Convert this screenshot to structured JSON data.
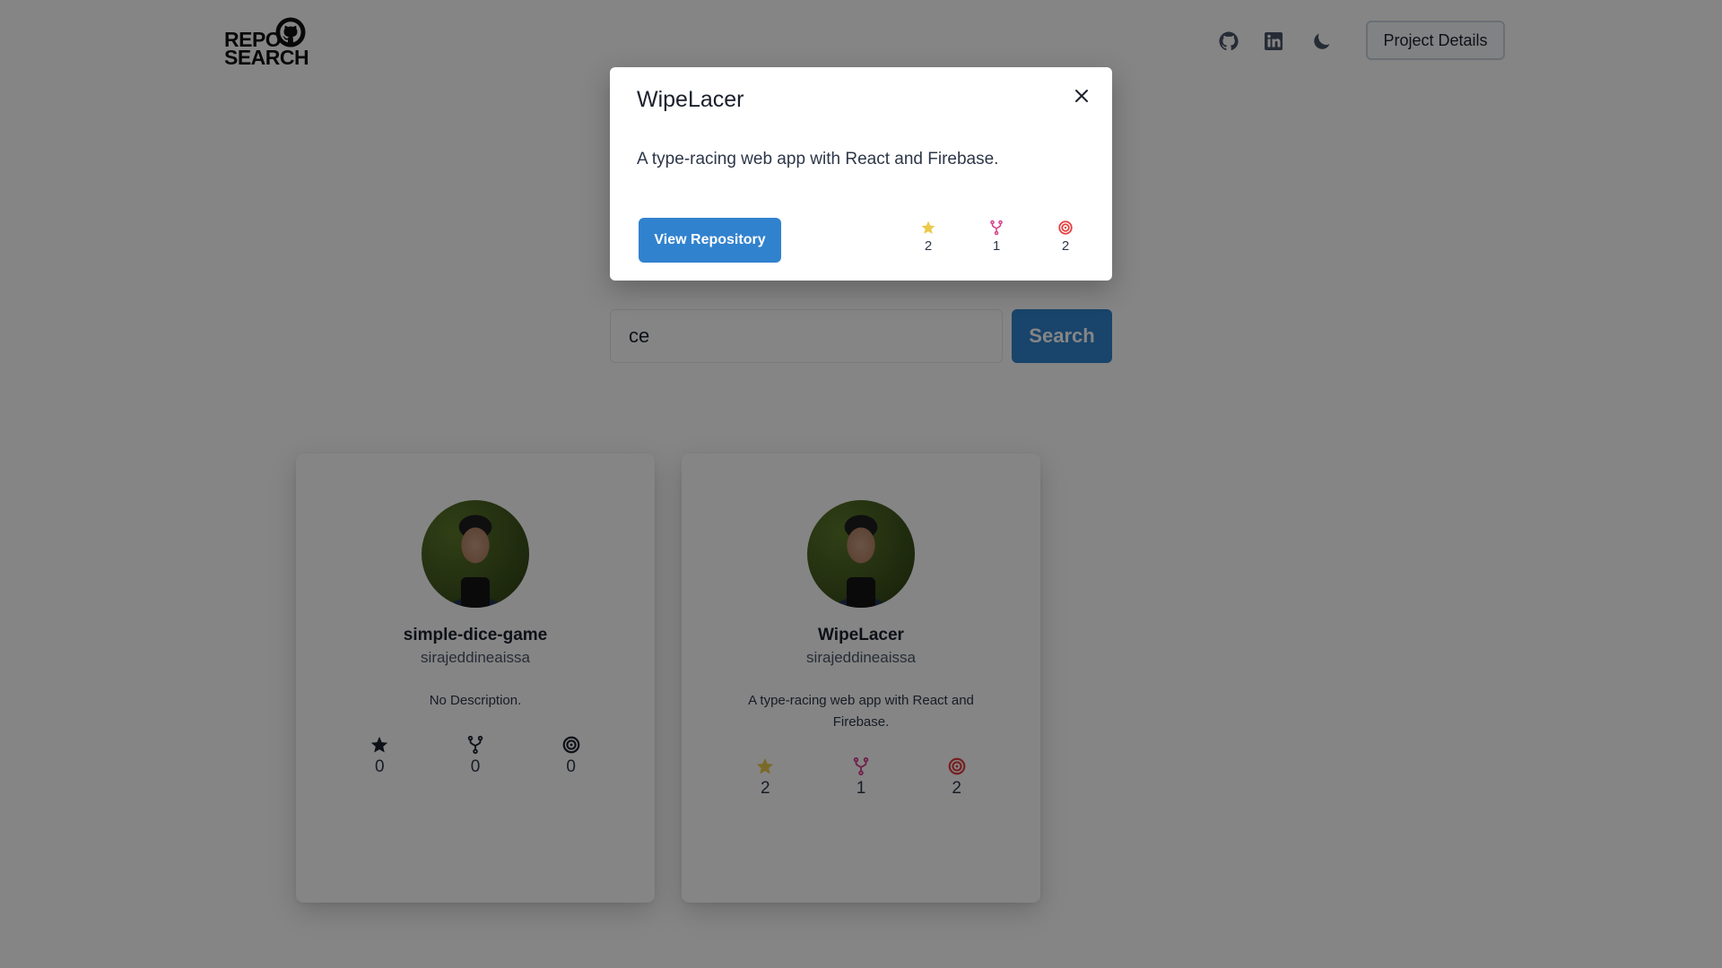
{
  "header": {
    "logo_line1": "REPO",
    "logo_line2": "SEARCH",
    "project_details_label": "Project Details",
    "icons": [
      "github-icon",
      "linkedin-icon",
      "moon-icon"
    ]
  },
  "search": {
    "value": "ce",
    "button_label": "Search"
  },
  "cards": [
    {
      "repo_name": "simple-dice-game",
      "owner": "sirajeddineaissa",
      "description": "No Description.",
      "stars": "0",
      "forks": "0",
      "watchers": "0"
    },
    {
      "repo_name": "WipeLacer",
      "owner": "sirajeddineaissa",
      "description": "A type-racing web app with React and Firebase.",
      "stars": "2",
      "forks": "1",
      "watchers": "2"
    }
  ],
  "modal": {
    "title": "WipeLacer",
    "description": "A type-racing web app with React and Firebase.",
    "view_button_label": "View Repository",
    "stars": "2",
    "forks": "1",
    "watchers": "2"
  },
  "colors": {
    "accent": "#3182ce",
    "star_active": "#ecc94b",
    "fork_active": "#d53f8c",
    "watch_active": "#e53e3e",
    "inactive": "#1a202c"
  }
}
